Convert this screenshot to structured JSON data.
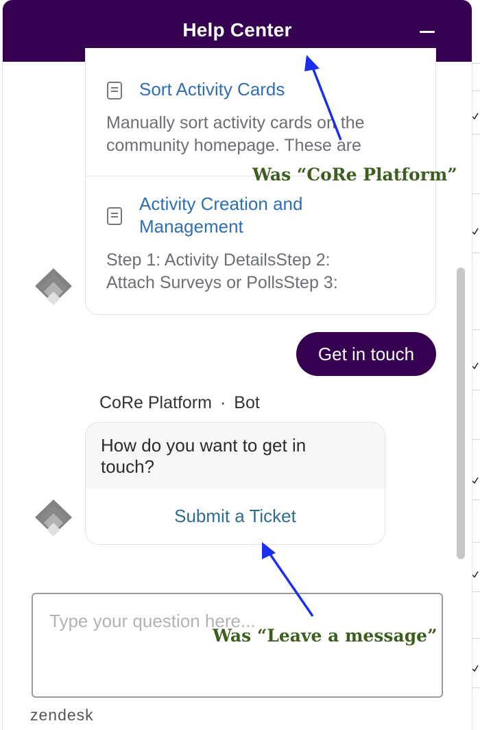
{
  "header": {
    "title": "Help Center",
    "minimize_icon": "minus-icon",
    "background": "#34004f"
  },
  "articles": [
    {
      "title": "Sort Activity Cards",
      "description_lines": [
        "Manually sort activity cards on the",
        "community homepage. These are"
      ],
      "icon": "document-icon"
    },
    {
      "title_lines": [
        "Activity Creation and",
        "Management"
      ],
      "description_lines": [
        "Step 1: Activity DetailsStep 2:",
        "Attach Surveys or PollsStep 3:"
      ],
      "icon": "document-icon"
    }
  ],
  "get_in_touch_button": "Get in touch",
  "bot_message": {
    "sender_name": "CoRe Platform",
    "separator": "·",
    "sender_role": "Bot",
    "question_lines": [
      "How do you want to get in",
      "touch?"
    ],
    "option": "Submit a Ticket"
  },
  "composer": {
    "placeholder": "Type your question here..."
  },
  "branding": "zendesk",
  "annotations": {
    "top": "Was “CoRe Platform”",
    "bottom": "Was “Leave a message”"
  },
  "colors": {
    "brand": "#34004f",
    "link": "#2e6fb4",
    "option_link": "#2f6b8f",
    "annotation_text": "#3e5e1f",
    "arrow": "#1a2ef0"
  }
}
